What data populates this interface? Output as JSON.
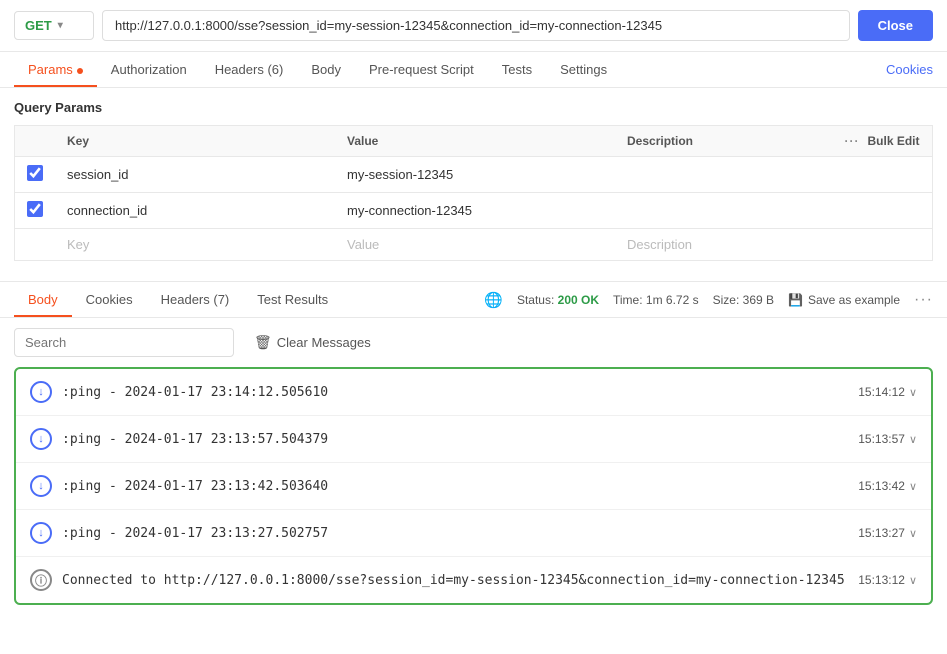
{
  "topbar": {
    "method": "GET",
    "method_color": "#2d9b47",
    "url": "http://127.0.0.1:8000/sse?session_id=my-session-12345&connection_id=my-connection-12345",
    "close_label": "Close"
  },
  "tabs": {
    "items": [
      {
        "label": "Params",
        "active": true,
        "dot": true,
        "id": "params"
      },
      {
        "label": "Authorization",
        "active": false,
        "id": "authorization"
      },
      {
        "label": "Headers",
        "active": false,
        "badge": "(6)",
        "id": "headers"
      },
      {
        "label": "Body",
        "active": false,
        "id": "body"
      },
      {
        "label": "Pre-request Script",
        "active": false,
        "id": "pre-request-script"
      },
      {
        "label": "Tests",
        "active": false,
        "id": "tests"
      },
      {
        "label": "Settings",
        "active": false,
        "id": "settings"
      }
    ],
    "cookies_link": "Cookies"
  },
  "query_params": {
    "section_title": "Query Params",
    "columns": {
      "key": "Key",
      "value": "Value",
      "description": "Description",
      "bulk_edit": "Bulk Edit"
    },
    "rows": [
      {
        "checked": true,
        "key": "session_id",
        "value": "my-session-12345",
        "description": ""
      },
      {
        "checked": true,
        "key": "connection_id",
        "value": "my-connection-12345",
        "description": ""
      }
    ],
    "empty_row": {
      "key_placeholder": "Key",
      "value_placeholder": "Value",
      "description_placeholder": "Description"
    }
  },
  "response": {
    "tabs": [
      {
        "label": "Body",
        "active": true,
        "id": "body"
      },
      {
        "label": "Cookies",
        "active": false,
        "id": "cookies"
      },
      {
        "label": "Headers",
        "badge": "(7)",
        "active": false,
        "id": "headers"
      },
      {
        "label": "Test Results",
        "active": false,
        "id": "test-results"
      }
    ],
    "status_label": "Status:",
    "status_value": "200 OK",
    "time_label": "Time:",
    "time_value": "1m 6.72 s",
    "size_label": "Size:",
    "size_value": "369 B",
    "save_example": "Save as example"
  },
  "search": {
    "placeholder": "Search",
    "clear_label": "Clear Messages"
  },
  "messages": [
    {
      "type": "ping",
      "icon": "arrow-down",
      "text": ":ping - 2024-01-17 23:14:12.505610",
      "time": "15:14:12"
    },
    {
      "type": "ping",
      "icon": "arrow-down",
      "text": ":ping - 2024-01-17 23:13:57.504379",
      "time": "15:13:57"
    },
    {
      "type": "ping",
      "icon": "arrow-down",
      "text": ":ping - 2024-01-17 23:13:42.503640",
      "time": "15:13:42"
    },
    {
      "type": "ping",
      "icon": "arrow-down",
      "text": ":ping - 2024-01-17 23:13:27.502757",
      "time": "15:13:27"
    },
    {
      "type": "info",
      "icon": "info",
      "text": "Connected to http://127.0.0.1:8000/sse?session_id=my-session-12345&connection_id=my-connection-12345",
      "time": "15:13:12"
    }
  ]
}
